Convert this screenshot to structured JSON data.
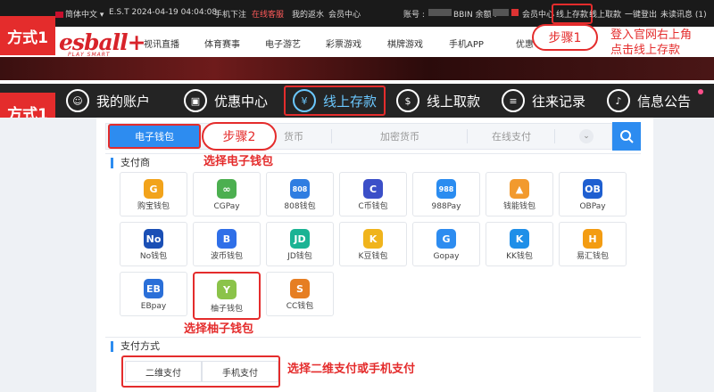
{
  "topbar": {
    "language": "简体中文",
    "datetime": "E.S.T 2024-04-19 04:04:08",
    "mobile_order": "手机下注",
    "online_service": "在线客服",
    "my_rebate": "我的返水",
    "member_center": "会员中心",
    "account_label": "账号 :",
    "account_value": "",
    "balance_label": "BBIN 余额 :",
    "balance_value": "",
    "member_center_right": "会员中心",
    "deposit": "线上存款",
    "withdraw": "线上取款",
    "one_click_logout": "一键登出",
    "unread": "未读讯息 (1)"
  },
  "logo": {
    "main": "esball+",
    "sub": "PLAY SMART"
  },
  "nav": [
    "视讯直播",
    "体育赛事",
    "电子游艺",
    "彩票游戏",
    "棋牌游戏",
    "手机APP",
    "优惠"
  ],
  "labels": {
    "method1_top": "方式1",
    "method1_bottom": "方式1",
    "step1": "步骤1",
    "step2": "步骤2",
    "step1_note_line1": "登入官网右上角",
    "step1_note_line2": "点击线上存款",
    "choose_wallet": "选择电子钱包",
    "choose_yuzi": "选择柚子钱包",
    "choose_mode": "选择二维支付或手机支付"
  },
  "menu": [
    {
      "label": "我的账户",
      "icon": "user-icon"
    },
    {
      "label": "优惠中心",
      "icon": "gift-icon"
    },
    {
      "label": "线上存款",
      "icon": "deposit-icon"
    },
    {
      "label": "线上取款",
      "icon": "withdraw-icon"
    },
    {
      "label": "往来记录",
      "icon": "record-icon"
    },
    {
      "label": "信息公告",
      "icon": "bell-icon"
    }
  ],
  "tabs": [
    "电子钱包",
    "货币",
    "加密货币",
    "在线支付"
  ],
  "sections": {
    "providers": "支付商",
    "pay_mode": "支付方式"
  },
  "providers": [
    {
      "name": "购宝钱包",
      "color": "#f2a31b",
      "glyph": "G"
    },
    {
      "name": "CGPay",
      "color": "#4caf50",
      "glyph": "∞"
    },
    {
      "name": "808钱包",
      "color": "#2f7de1",
      "glyph": "808"
    },
    {
      "name": "C币钱包",
      "color": "#3b4fc8",
      "glyph": "C"
    },
    {
      "name": "988Pay",
      "color": "#2a8cf0",
      "glyph": "988"
    },
    {
      "name": "钱能钱包",
      "color": "#f29a2e",
      "glyph": "▲"
    },
    {
      "name": "OBPay",
      "color": "#1f5fd0",
      "glyph": "OB"
    },
    {
      "name": "No钱包",
      "color": "#1a4fb5",
      "glyph": "No"
    },
    {
      "name": "波币钱包",
      "color": "#2f6fe8",
      "glyph": "B"
    },
    {
      "name": "JD钱包",
      "color": "#1ab394",
      "glyph": "JD"
    },
    {
      "name": "K豆钱包",
      "color": "#f0b41c",
      "glyph": "K"
    },
    {
      "name": "Gopay",
      "color": "#2d8cf0",
      "glyph": "G"
    },
    {
      "name": "KK钱包",
      "color": "#1f8fe8",
      "glyph": "K"
    },
    {
      "name": "易汇钱包",
      "color": "#f39c12",
      "glyph": "H"
    },
    {
      "name": "EBpay",
      "color": "#2a6fd8",
      "glyph": "EB"
    },
    {
      "name": "柚子钱包",
      "color": "#8bc34a",
      "glyph": "Y"
    },
    {
      "name": "CC钱包",
      "color": "#e67e22",
      "glyph": "S"
    }
  ],
  "pay_modes": [
    "二维支付",
    "手机支付"
  ]
}
